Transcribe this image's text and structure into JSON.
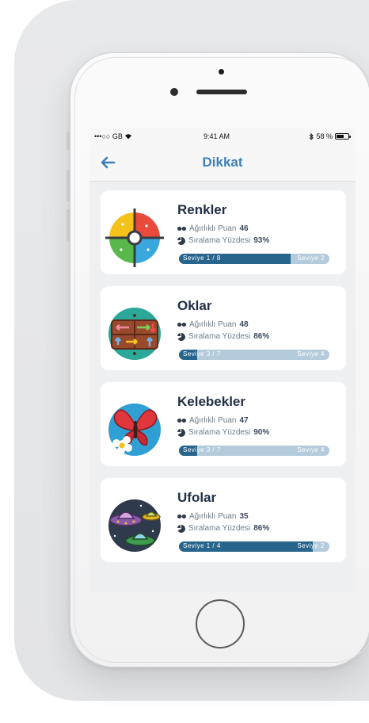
{
  "status_bar": {
    "carrier": "•••○○ GB",
    "time": "9:41 AM",
    "battery": "58 %"
  },
  "nav": {
    "title": "Dikkat",
    "back_icon": "back-arrow-icon"
  },
  "stat_labels": {
    "weighted_score": "Ağırlıklı Puan",
    "rank_percent": "Sıralama Yüzdesi"
  },
  "games": [
    {
      "name": "Renkler",
      "icon": "color-wheel-icon",
      "weighted_score": "46",
      "rank_percent": "93%",
      "level_current": "Seviye 1 / 8",
      "level_next": "Seviye 2",
      "progress": 0.74
    },
    {
      "name": "Oklar",
      "icon": "arrows-board-icon",
      "weighted_score": "48",
      "rank_percent": "86%",
      "level_current": "Seviye 3 / 7",
      "level_next": "Seviye 4",
      "progress": 0.12
    },
    {
      "name": "Kelebekler",
      "icon": "butterfly-icon",
      "weighted_score": "47",
      "rank_percent": "90%",
      "level_current": "Seviye 3 / 7",
      "level_next": "Seviye 4",
      "progress": 0.12
    },
    {
      "name": "Ufolar",
      "icon": "ufo-icon",
      "weighted_score": "35",
      "rank_percent": "86%",
      "level_current": "Seviye 1 / 4",
      "level_next": "Seviye 2",
      "progress": 0.89
    }
  ],
  "colors": {
    "accent": "#3d7fb9",
    "progress_fill": "#27658c",
    "progress_track": "#b4cbdc"
  }
}
